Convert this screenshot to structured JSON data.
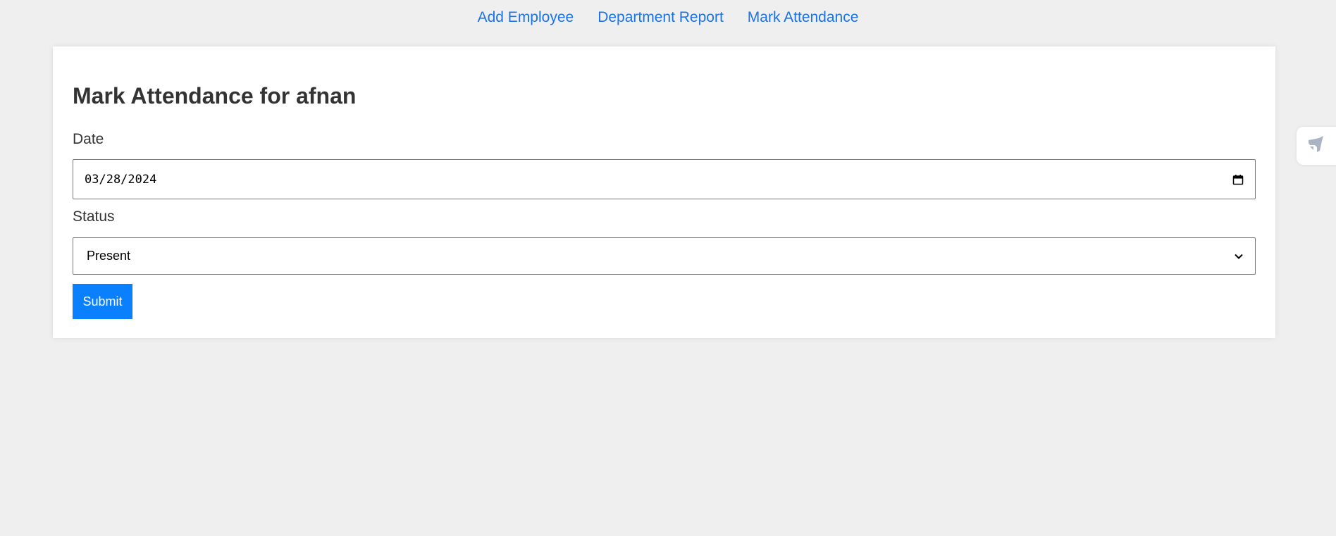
{
  "nav": {
    "links": [
      {
        "label": "Add Employee"
      },
      {
        "label": "Department Report"
      },
      {
        "label": "Mark Attendance"
      }
    ]
  },
  "form": {
    "title": "Mark Attendance for afnan",
    "date_label": "Date",
    "date_value": "03/28/2024",
    "status_label": "Status",
    "status_value": "Present",
    "submit_label": "Submit"
  },
  "icons": {
    "calendar": "calendar-icon",
    "dropdown": "chevron-down-icon",
    "side_widget": "rocket-icon"
  },
  "colors": {
    "link": "#1a73e8",
    "button": "#0a80fe",
    "background": "#efefef"
  }
}
